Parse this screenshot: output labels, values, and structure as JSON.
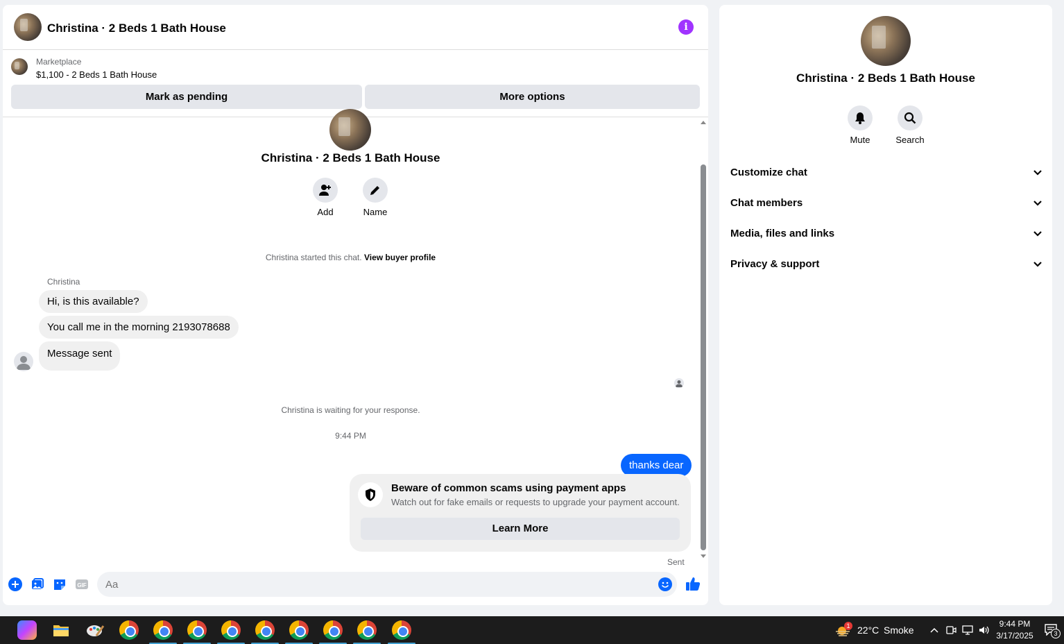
{
  "chat": {
    "title": "Christina · 2 Beds 1 Bath House",
    "marketplace_label": "Marketplace",
    "listing": "$1,100 - 2 Beds 1 Bath House",
    "mark_pending": "Mark as pending",
    "more_options": "More options"
  },
  "thread": {
    "title": "Christina · 2 Beds 1 Bath House",
    "add_label": "Add",
    "name_label": "Name",
    "started_text": "Christina started this chat.",
    "view_profile": "View buyer profile",
    "sender": "Christina",
    "messages": [
      "Hi, is this available?",
      "You call me in the morning 2193078688",
      "Message sent"
    ],
    "waiting": "Christina is waiting for your response.",
    "timestamp": "9:44 PM",
    "outgoing": "thanks dear",
    "scam_title": "Beware of common scams using payment apps",
    "scam_sub": "Watch out for fake emails or requests to upgrade your payment account.",
    "learn_more": "Learn More",
    "sent_status": "Sent"
  },
  "composer": {
    "placeholder": "Aa"
  },
  "info_panel": {
    "title": "Christina · 2 Beds 1 Bath House",
    "mute": "Mute",
    "search": "Search",
    "sections": [
      "Customize chat",
      "Chat members",
      "Media, files and links",
      "Privacy & support"
    ]
  },
  "taskbar": {
    "weather_temp": "22°C",
    "weather_desc": "Smoke",
    "weather_badge": "1",
    "time": "9:44 PM",
    "date": "3/17/2025",
    "notif_count": "3"
  },
  "colors": {
    "accent": "#0866ff",
    "info": "#a033ff"
  }
}
